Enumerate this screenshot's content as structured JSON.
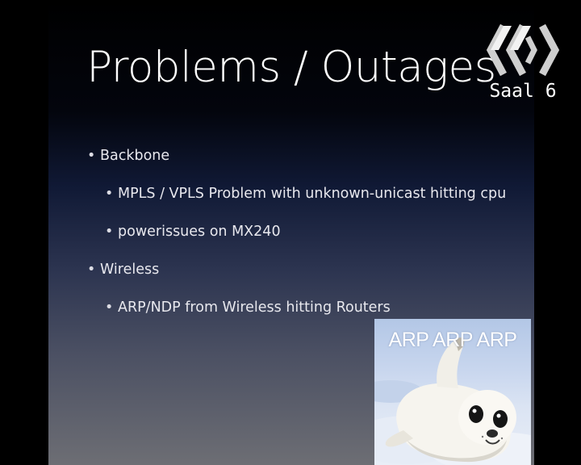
{
  "slide": {
    "title": "Problems / Outages",
    "bullets": [
      {
        "level": 1,
        "text": "Backbone"
      },
      {
        "level": 2,
        "text": "MPLS / VPLS Problem with unknown-unicast hitting cpu"
      },
      {
        "level": 2,
        "text": "powerissues on MX240"
      },
      {
        "level": 1,
        "text": "Wireless"
      },
      {
        "level": 2,
        "text": "ARP/NDP from Wireless hitting Routers"
      }
    ]
  },
  "logo": {
    "icon": "ccc-logo-icon",
    "room": "Saal 6"
  },
  "photo": {
    "caption": "ARP ARP ARP",
    "subject": "seal-pup-icon"
  },
  "colors": {
    "background": "#000000",
    "title": "#ffffff",
    "bullet_text": "#e8e8ee",
    "snow": "#dbe4f3"
  }
}
